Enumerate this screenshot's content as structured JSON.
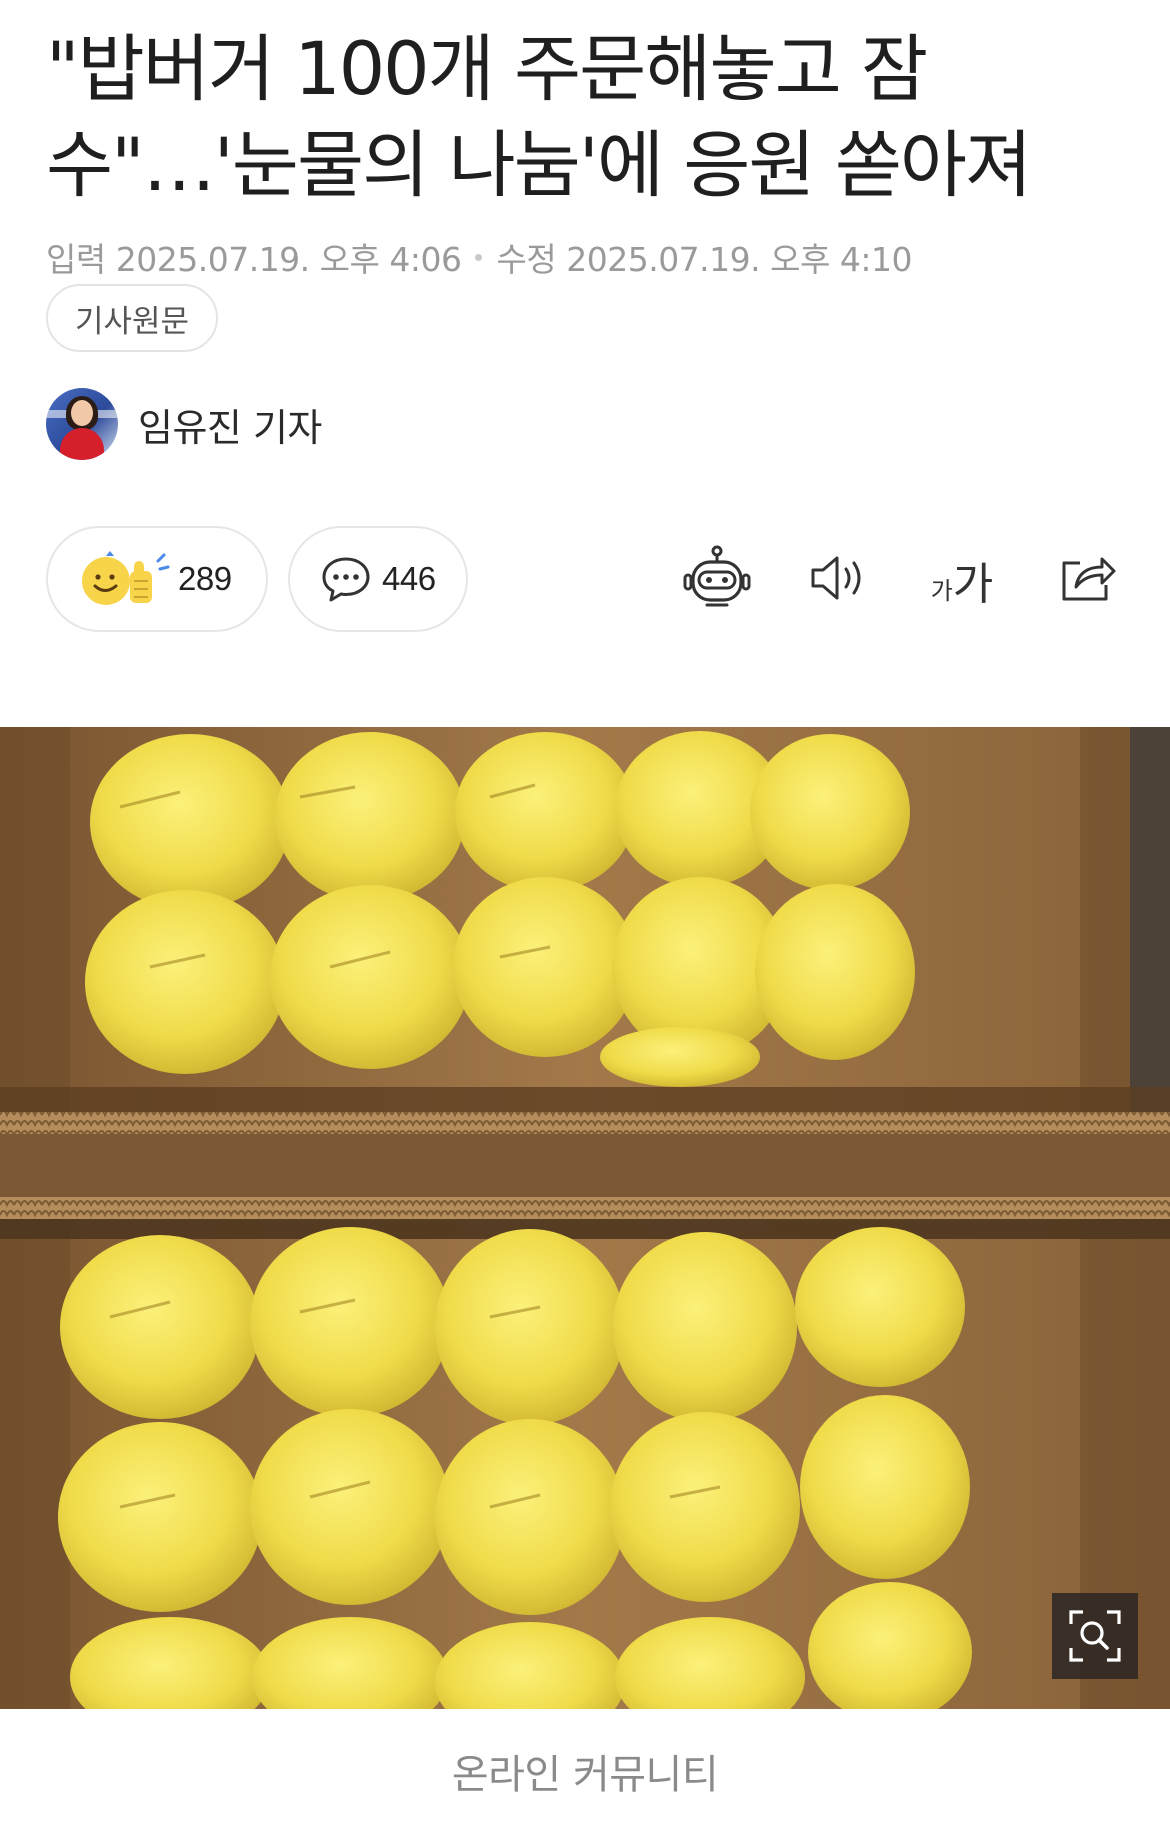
{
  "article": {
    "headline_line1": "\"밥버거 100개 주문해놓고 잠",
    "headline_line2": "수\"…'눈물의 나눔'에 응원 쏟아져",
    "input_label": "입력",
    "input_datetime": "2025.07.19. 오후 4:06",
    "modified_label": "수정",
    "modified_datetime": "2025.07.19. 오후 4:10",
    "source_button": "기사원문",
    "reporter_name": "임유진 기자"
  },
  "actions": {
    "reaction_count": "289",
    "comment_count": "446",
    "font_small_glyph": "가",
    "font_big_glyph": "가"
  },
  "icons": {
    "reaction": "emoji-thumbs-up-icon",
    "comment": "speech-bubble-icon",
    "summary": "robot-icon",
    "listen": "speaker-icon",
    "font": "font-size-icon",
    "share": "share-icon",
    "zoom": "zoom-search-icon"
  },
  "photo": {
    "caption": "온라인 커뮤니티"
  },
  "colors": {
    "wrapper_yellow": "#f3e24e",
    "cardboard": "#a07a4c",
    "text_muted": "#9a9a9a"
  }
}
